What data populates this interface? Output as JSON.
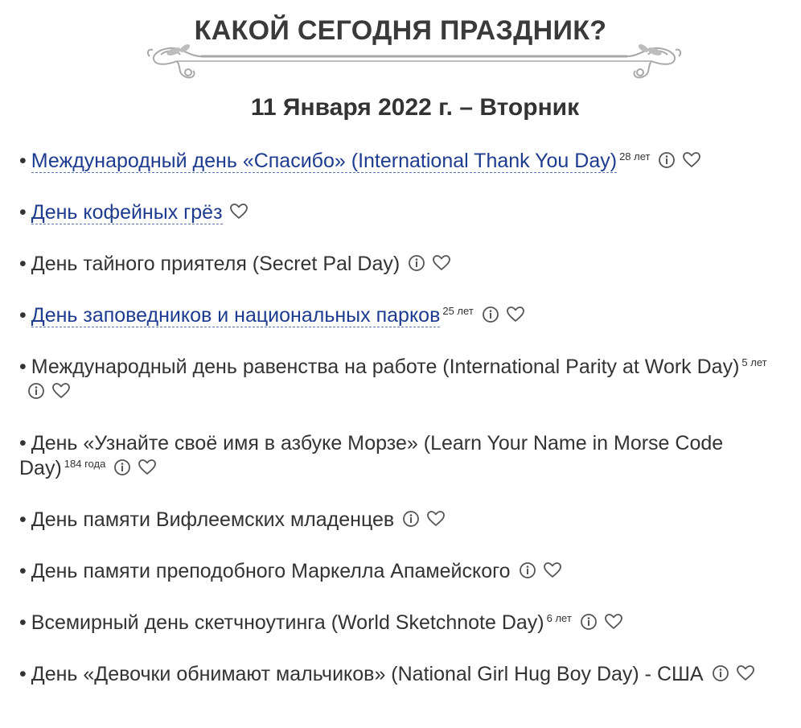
{
  "header": {
    "title": "КАКОЙ СЕГОДНЯ ПРАЗДНИК?",
    "date": "11 Января 2022 г. – Вторник"
  },
  "bullet": "•",
  "holidays": [
    {
      "name": "Международный день «Спасибо» (International Thank You Day)",
      "link": true,
      "age": "28 лет",
      "info": true
    },
    {
      "name": "День кофейных грёз",
      "link": true,
      "age": "",
      "info": false
    },
    {
      "name": "День тайного приятеля (Secret Pal Day)",
      "link": false,
      "age": "",
      "info": true
    },
    {
      "name": "День заповедников и национальных парков",
      "link": true,
      "age": "25 лет",
      "info": true
    },
    {
      "name": "Международный день равенства на работе (International Parity at Work Day)",
      "link": false,
      "age": "5 лет",
      "info": true
    },
    {
      "name": "День «Узнайте своё имя в азбуке Морзе» (Learn Your Name in Morse Code Day)",
      "link": false,
      "age": "184 года",
      "info": true
    },
    {
      "name": "День памяти Вифлеемских младенцев",
      "link": false,
      "age": "",
      "info": true
    },
    {
      "name": "День памяти преподобного Маркелла Апамейского",
      "link": false,
      "age": "",
      "info": true
    },
    {
      "name": "Всемирный день скетчноутинга (World Sketchnote Day)",
      "link": false,
      "age": "6 лет",
      "info": true
    },
    {
      "name": "День «Девочки обнимают мальчиков» (National Girl Hug Boy Day) - США",
      "link": false,
      "age": "",
      "info": true
    }
  ],
  "icons": {
    "info": "info-icon",
    "favorite": "heart-icon"
  },
  "colors": {
    "link": "#1d3c8f",
    "text": "#333333",
    "icon": "#555555",
    "ornament": "#a8a8a8"
  }
}
